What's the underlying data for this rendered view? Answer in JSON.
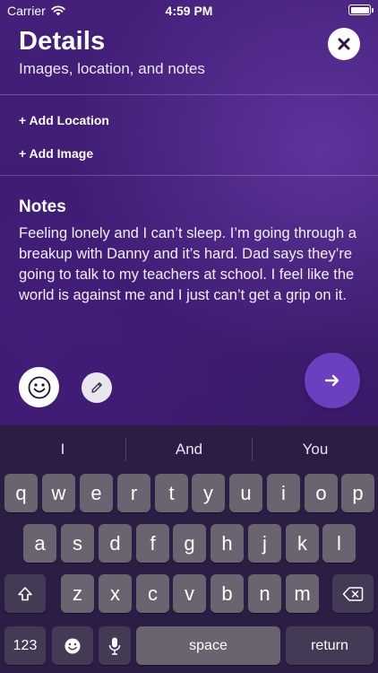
{
  "status_bar": {
    "carrier": "Carrier",
    "time": "4:59 PM"
  },
  "header": {
    "title": "Details",
    "subtitle": "Images, location, and notes"
  },
  "actions": {
    "add_location": "+ Add Location",
    "add_image": "+ Add Image"
  },
  "notes": {
    "heading": "Notes",
    "text": "Feeling lonely and I can’t sleep. I’m going through a breakup with Danny and it’s hard. Dad says they’re going to talk to my teachers at school. I feel like the world is against me and I just can’t get a grip on it."
  },
  "icons": {
    "close": "close-icon",
    "emoji": "smiley-icon",
    "pencil": "pencil-icon",
    "next": "arrow-right-icon"
  },
  "colors": {
    "accent": "#6a3fc0",
    "background": "#3d1d70"
  },
  "keyboard": {
    "suggestions": [
      "I",
      "And",
      "You"
    ],
    "row1": [
      "q",
      "w",
      "e",
      "r",
      "t",
      "y",
      "u",
      "i",
      "o",
      "p"
    ],
    "row2": [
      "a",
      "s",
      "d",
      "f",
      "g",
      "h",
      "j",
      "k",
      "l"
    ],
    "row3": [
      "z",
      "x",
      "c",
      "v",
      "b",
      "n",
      "m"
    ],
    "numbers_key": "123",
    "space_key": "space",
    "return_key": "return"
  }
}
